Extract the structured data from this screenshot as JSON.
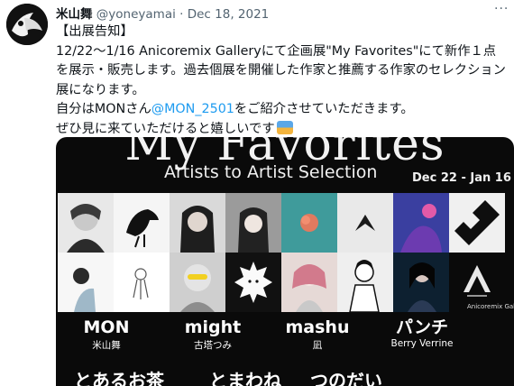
{
  "tweet": {
    "display_name": "米山舞",
    "handle": "@yoneyamai",
    "separator": "·",
    "date": "Dec 18, 2021",
    "more_glyph": "···",
    "line1": "【出展告知】",
    "line2": "12/22～1/16 Anicoremix Galleryにて企画展\"My Favorites\"にて新作１点を展示・販売します。過去個展を開催した作家と推薦する作家のセレクション展になります。",
    "line3_pre": "自分はMONさん",
    "mention": "@MON_2501",
    "line3_post": "をご紹介させていただきます。",
    "line4": "ぜひ見に来ていただけると嬉しいです"
  },
  "poster": {
    "title": "My Favorites",
    "subtitle": "Artists to Artist Selection",
    "dates": "Dec 22 - Jan 16",
    "brand": "Anicoremix Gallery",
    "artists": [
      {
        "name": "MON",
        "sub": "米山舞"
      },
      {
        "name": "might",
        "sub": "古塔つみ"
      },
      {
        "name": "mashu",
        "sub": "凪"
      },
      {
        "name": "パンチ",
        "sub": "Berry Verrine"
      }
    ],
    "cut_row": [
      "とあるお茶",
      "とまわね",
      "つのだい"
    ]
  },
  "colors": {
    "link": "#1d9bf0",
    "text": "#0f1419",
    "muted": "#536471",
    "poster_bg": "#0a0a0a"
  }
}
